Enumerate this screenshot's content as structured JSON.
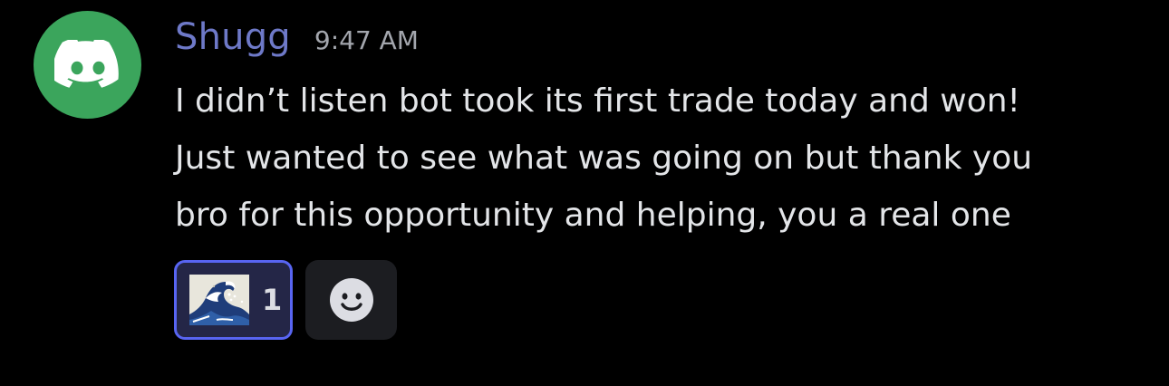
{
  "message": {
    "avatar_icon": "discord-logo-icon",
    "avatar_color": "#3ba55c",
    "author": "Shugg",
    "author_color": "#6e79c8",
    "timestamp": "9:47 AM",
    "lines": [
      "I didn’t listen bot took its first trade today and won!",
      "Just wanted to see what was going on but thank you",
      "bro for this opportunity and helping, you a real one"
    ]
  },
  "reactions": [
    {
      "emoji_icon": "wave-emoji-icon",
      "count": "1",
      "active": true,
      "accent": "#5865f2"
    }
  ],
  "add_reaction": {
    "icon": "add-reaction-smiley-icon"
  }
}
